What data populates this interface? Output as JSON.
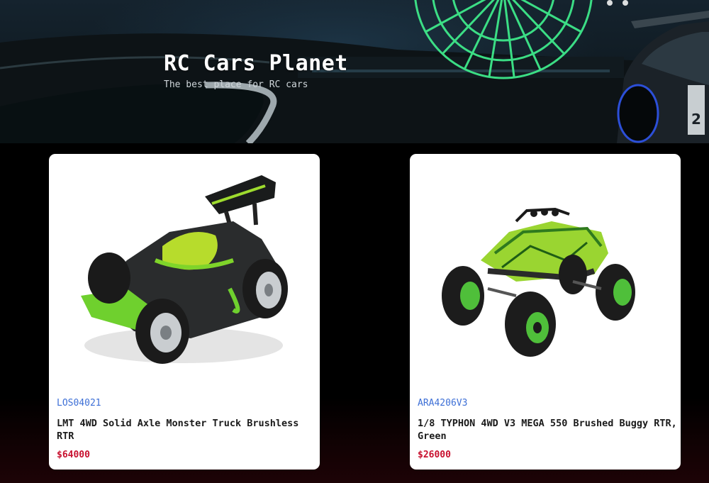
{
  "header": {
    "title": "RC Cars Planet",
    "subtitle": "The best place for RC cars"
  },
  "products": [
    {
      "sku": "LOS04021",
      "name": "LMT 4WD Solid Axle Monster Truck Brushless RTR",
      "price": "$64000",
      "image": "green-black-rc-buggy"
    },
    {
      "sku": "ARA4206V3",
      "name": "1/8 TYPHON 4WD V3 MEGA 550 Brushed Buggy RTR, Green",
      "price": "$26000",
      "image": "green-camo-rc-crawler"
    }
  ],
  "colors": {
    "sku": "#3d6fd6",
    "price": "#c8102e",
    "card_bg": "#ffffff",
    "page_bg": "#000000",
    "neon": "#3ee88a"
  }
}
